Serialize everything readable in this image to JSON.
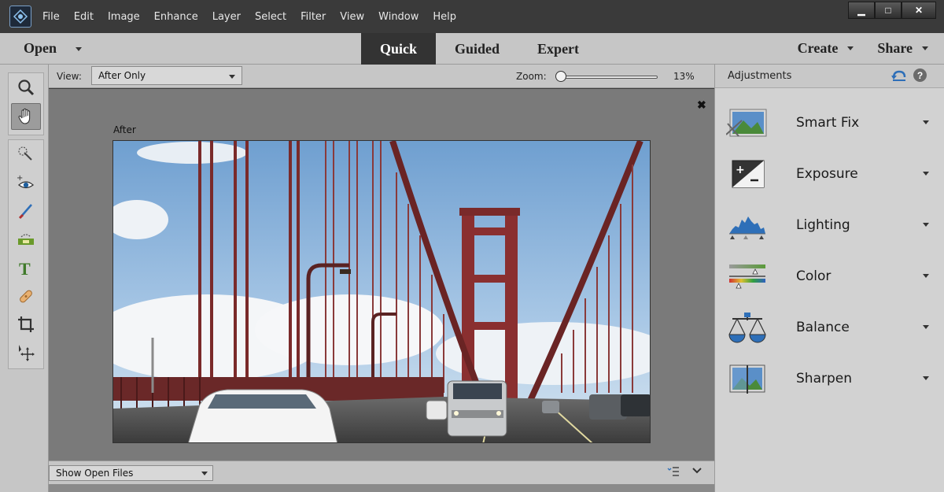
{
  "menu": [
    "File",
    "Edit",
    "Image",
    "Enhance",
    "Layer",
    "Select",
    "Filter",
    "View",
    "Window",
    "Help"
  ],
  "window_controls": {
    "minimize": "▁",
    "maximize": "□",
    "close": "✕"
  },
  "modebar": {
    "open_label": "Open",
    "tabs": [
      "Quick",
      "Guided",
      "Expert"
    ],
    "active_tab": "Quick",
    "create_label": "Create",
    "share_label": "Share"
  },
  "tools": [
    "zoom-icon",
    "hand-icon",
    "quick-selection-icon",
    "red-eye-icon",
    "whiten-teeth-icon",
    "straighten-icon",
    "type-icon",
    "spot-healing-icon",
    "crop-icon",
    "move-icon"
  ],
  "options": {
    "view_label": "View:",
    "view_value": "After Only",
    "zoom_label": "Zoom:",
    "zoom_value": "13%",
    "zoom_level": 0.0
  },
  "canvas": {
    "after_label": "After",
    "close_glyph": "✖"
  },
  "bottombar": {
    "files_value": "Show Open Files"
  },
  "panel": {
    "title": "Adjustments",
    "items": [
      {
        "label": "Smart Fix",
        "icon": "smart-fix-icon"
      },
      {
        "label": "Exposure",
        "icon": "exposure-icon"
      },
      {
        "label": "Lighting",
        "icon": "lighting-icon"
      },
      {
        "label": "Color",
        "icon": "color-icon"
      },
      {
        "label": "Balance",
        "icon": "balance-icon"
      },
      {
        "label": "Sharpen",
        "icon": "sharpen-icon"
      }
    ]
  },
  "colors": {
    "accent_blue": "#2e6fb8",
    "active_tab_bg": "#333333",
    "panel_bg": "#d2d2d2",
    "bridge_red": "#8a2f30",
    "sky_blue": "#8fb8dc"
  }
}
